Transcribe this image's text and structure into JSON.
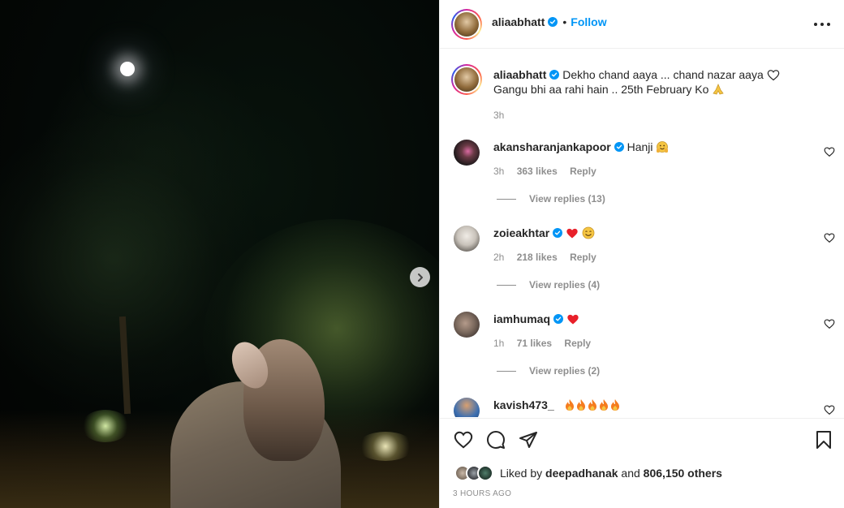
{
  "post": {
    "author": "aliaabhatt",
    "follow_label": "Follow",
    "dot": "•"
  },
  "caption": {
    "username": "aliaabhatt",
    "line1": "Dekho chand aaya ... chand nazar aaya",
    "line2": "Gangu bhi aa rahi hain .. 25th February Ko",
    "time": "3h"
  },
  "comments": [
    {
      "username": "akansharanjankapoor",
      "text": "Hanji",
      "time": "3h",
      "likes": "363 likes",
      "reply": "Reply",
      "view_replies": "View replies (13)"
    },
    {
      "username": "zoieakhtar",
      "text": "",
      "time": "2h",
      "likes": "218 likes",
      "reply": "Reply",
      "view_replies": "View replies (4)"
    },
    {
      "username": "iamhumaq",
      "text": "",
      "time": "1h",
      "likes": "71 likes",
      "reply": "Reply",
      "view_replies": "View replies (2)"
    },
    {
      "username": "kavish473_",
      "text": "",
      "time": "",
      "likes": "",
      "reply": "",
      "view_replies": ""
    }
  ],
  "likes": {
    "prefix": "Liked by",
    "user": "deepadhanak",
    "and": "and",
    "count": "806,150 others"
  },
  "timestamp": "3 HOURS AGO",
  "icons": {
    "like": "heart-icon",
    "comment": "comment-icon",
    "share": "share-icon",
    "save": "bookmark-icon",
    "more": "more-icon",
    "next": "chevron-right-icon",
    "verified": "verified-badge-icon"
  },
  "colors": {
    "accent": "#0095f6",
    "heart_red": "#ed4956",
    "muted_text": "#8e8e8e"
  }
}
